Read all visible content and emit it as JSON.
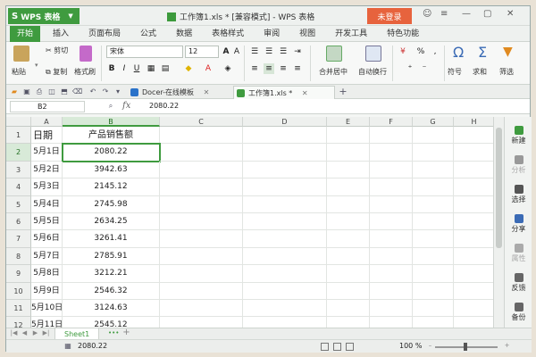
{
  "app": {
    "button_label": "WPS 表格",
    "logo_letter": "S",
    "title": "工作簿1.xls * [兼容模式] - WPS 表格",
    "login_label": "未登录"
  },
  "ribbon_tabs": [
    "开始",
    "插入",
    "页面布局",
    "公式",
    "数据",
    "表格样式",
    "审阅",
    "视图",
    "开发工具",
    "特色功能"
  ],
  "ribbon": {
    "paste": "粘贴",
    "cut": "剪切",
    "copy": "复制",
    "format_painter": "格式刷",
    "font_name": "宋体",
    "font_size": "12",
    "merge_center": "合并居中",
    "wrap_text": "自动换行",
    "percent": "%",
    "symbol": "符号",
    "sum": "求和",
    "filter": "筛选"
  },
  "doc_tabs": [
    {
      "label": "Docer-在线模板"
    },
    {
      "label": "工作簿1.xls *"
    }
  ],
  "formula_bar": {
    "name_box": "B2",
    "fx": "fx",
    "value": "2080.22"
  },
  "columns": [
    "A",
    "B",
    "C",
    "D",
    "E",
    "F",
    "G",
    "H"
  ],
  "rows": [
    "1",
    "2",
    "3",
    "4",
    "5",
    "6",
    "7",
    "8",
    "9",
    "10",
    "11",
    "12"
  ],
  "table": {
    "header": {
      "a": "日期",
      "b": "产品销售额"
    },
    "data": [
      {
        "date": "5月1日",
        "value": "2080.22"
      },
      {
        "date": "5月2日",
        "value": "3942.63"
      },
      {
        "date": "5月3日",
        "value": "2145.12"
      },
      {
        "date": "5月4日",
        "value": "2745.98"
      },
      {
        "date": "5月5日",
        "value": "2634.25"
      },
      {
        "date": "5月6日",
        "value": "3261.41"
      },
      {
        "date": "5月7日",
        "value": "2785.91"
      },
      {
        "date": "5月8日",
        "value": "3212.21"
      },
      {
        "date": "5月9日",
        "value": "2546.32"
      },
      {
        "date": "5月10日",
        "value": "3124.63"
      },
      {
        "date": "5月11日",
        "value": "2545.12"
      }
    ]
  },
  "side_panel": [
    {
      "label": "新建",
      "icon": "new-icon",
      "enabled": true
    },
    {
      "label": "分析",
      "icon": "analyze-icon",
      "enabled": false
    },
    {
      "label": "选择",
      "icon": "select-icon",
      "enabled": true
    },
    {
      "label": "分享",
      "icon": "share-icon",
      "enabled": true
    },
    {
      "label": "属性",
      "icon": "properties-icon",
      "enabled": false
    },
    {
      "label": "反馈",
      "icon": "feedback-icon",
      "enabled": true
    },
    {
      "label": "备份",
      "icon": "backup-icon",
      "enabled": true
    }
  ],
  "sheet_tab": "Sheet1",
  "status": {
    "value": "2080.22",
    "zoom": "100 %"
  },
  "colors": {
    "accent": "#3f9b3f",
    "login": "#e7633d"
  }
}
